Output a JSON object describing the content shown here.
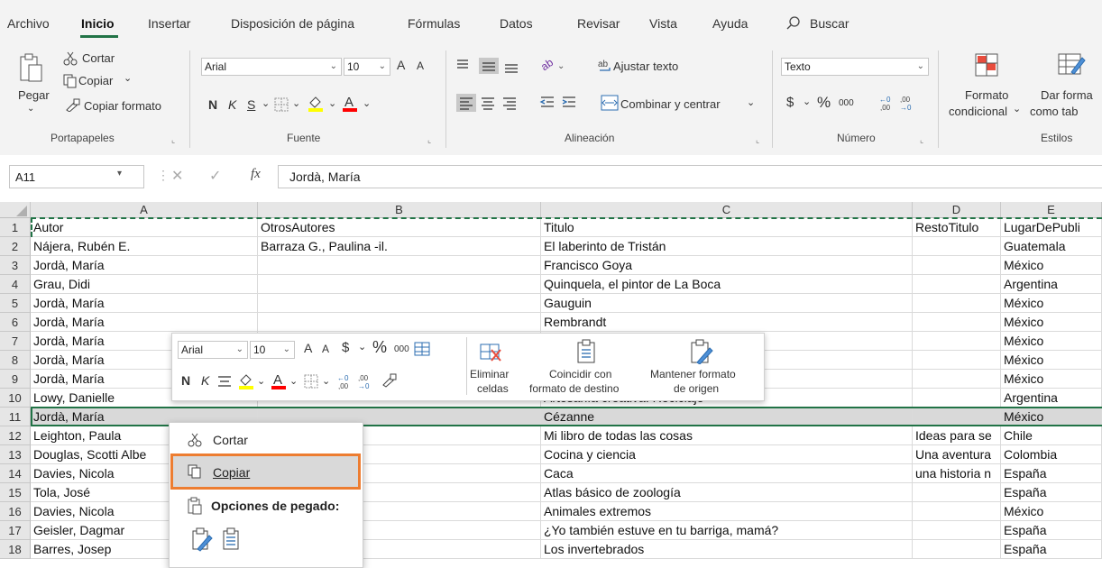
{
  "menu": {
    "tabs": [
      "Archivo",
      "Inicio",
      "Insertar",
      "Disposición de página",
      "Fórmulas",
      "Datos",
      "Revisar",
      "Vista",
      "Ayuda"
    ],
    "search_label": "Buscar"
  },
  "ribbon": {
    "portapapeles": {
      "paste_label": "Pegar",
      "cut_label": "Cortar",
      "copy_label": "Copiar",
      "format_painter_label": "Copiar formato",
      "group_label": "Portapapeles"
    },
    "fuente": {
      "font_name": "Arial",
      "font_size": "10",
      "bold": "N",
      "italic": "K",
      "underline": "S",
      "grow_font": "A",
      "shrink_font": "A",
      "group_label": "Fuente"
    },
    "alineacion": {
      "wrap_text_label": "Ajustar texto",
      "merge_center_label": "Combinar y centrar",
      "group_label": "Alineación"
    },
    "numero": {
      "format_value": "Texto",
      "currency_symbol": "$",
      "percent_symbol": "%",
      "thousands_label": "000",
      "group_label": "Número"
    },
    "estilos": {
      "conditional_format_line1": "Formato",
      "conditional_format_line2": "condicional",
      "table_format_line1": "Dar forma",
      "table_format_line2": "como tab",
      "group_label": "Estilos"
    }
  },
  "formula_bar": {
    "name_box": "A11",
    "fx_label": "fx",
    "content": "Jordà, María"
  },
  "sheet": {
    "columns": [
      "A",
      "B",
      "C",
      "D",
      "E"
    ],
    "row_numbers": [
      "1",
      "2",
      "3",
      "4",
      "5",
      "6",
      "7",
      "8",
      "9",
      "10",
      "11",
      "12",
      "13",
      "14",
      "15",
      "16",
      "17",
      "18"
    ],
    "rows": [
      [
        "Autor",
        "OtrosAutores",
        "Titulo",
        "RestoTitulo",
        "LugarDePubli"
      ],
      [
        "Nájera, Rubén E.",
        "Barraza G., Paulina -il.",
        "El laberinto de Tristán",
        "",
        "Guatemala"
      ],
      [
        "Jordà, María",
        "",
        "Francisco Goya",
        "",
        "México"
      ],
      [
        "Grau, Didi",
        "",
        "Quinquela, el pintor de La Boca",
        "",
        "Argentina"
      ],
      [
        "Jordà, María",
        "",
        "Gauguin",
        "",
        "México"
      ],
      [
        "Jordà, María",
        "",
        "Rembrandt",
        "",
        "México"
      ],
      [
        "Jordà, María",
        "",
        "",
        "",
        "México"
      ],
      [
        "Jordà, María",
        "",
        "",
        "",
        "México"
      ],
      [
        "Jordà, María",
        "",
        "",
        "",
        "México"
      ],
      [
        "Lowy, Danielle",
        "",
        "Artesanía creativa: Reciclaje",
        "",
        "Argentina"
      ],
      [
        "Jordà, María",
        "",
        "Cézanne",
        "",
        "México"
      ],
      [
        "Leighton, Paula",
        "",
        "Mi libro de todas las cosas",
        "Ideas para se",
        "Chile"
      ],
      [
        "Douglas, Scotti Albe",
        "",
        "Cocina y ciencia",
        "Una aventura",
        "Colombia"
      ],
      [
        "Davies, Nicola",
        "",
        "Caca",
        "una historia n",
        "España"
      ],
      [
        "Tola, José",
        "",
        "Atlas básico de zoología",
        "",
        "España"
      ],
      [
        "Davies, Nicola",
        "",
        "Animales extremos",
        "",
        "México"
      ],
      [
        "Geisler, Dagmar",
        "",
        "¿Yo también estuve en tu barriga, mamá?",
        "",
        "España"
      ],
      [
        "Barres, Josep",
        "",
        "Los invertebrados",
        "",
        "España"
      ]
    ]
  },
  "mini_toolbar": {
    "font_name": "Arial",
    "font_size": "10",
    "currency": "$",
    "percent": "%",
    "thousands": "000",
    "bold": "N",
    "italic": "K",
    "delete_cells_line1": "Eliminar",
    "delete_cells_line2": "celdas",
    "match_dest_line1": "Coincidir con",
    "match_dest_line2": "formato de destino",
    "keep_src_line1": "Mantener formato",
    "keep_src_line2": "de origen"
  },
  "context_menu": {
    "cut": "Cortar",
    "copy": "Copiar",
    "paste_options": "Opciones de pegado:"
  },
  "colors": {
    "excel_green": "#217346",
    "highlight_orange": "#ed7d31",
    "selection_grey": "#d9d9d9"
  }
}
